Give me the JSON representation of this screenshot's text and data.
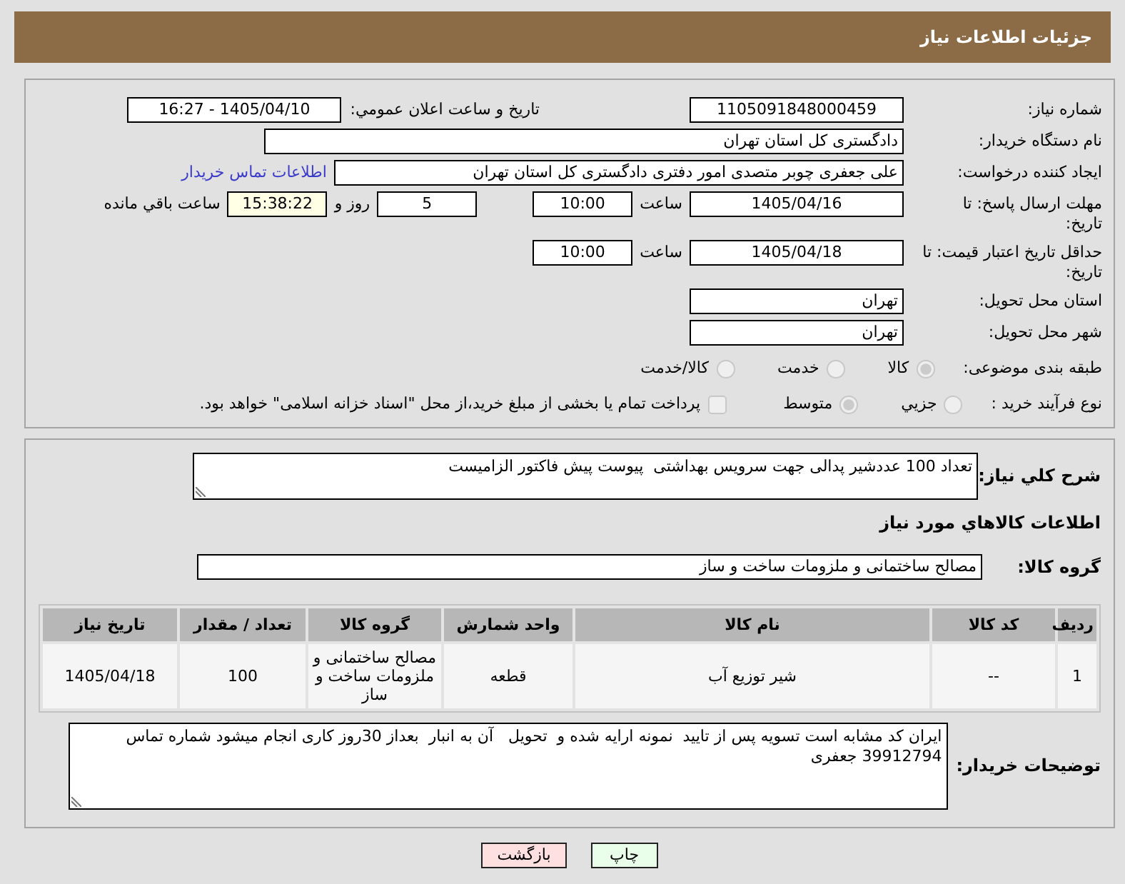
{
  "header": {
    "title": "جزئیات اطلاعات نیاز"
  },
  "need_details": {
    "need_number": {
      "label": "شماره نیاز:",
      "value": "1105091848000459"
    },
    "announcement": {
      "label": "تاریخ و ساعت اعلان عمومي:",
      "value": "1405/04/10 - 16:27"
    },
    "buyer_organization": {
      "label": "نام دستگاه خریدار:",
      "value": "دادگستری کل استان تهران"
    },
    "requester": {
      "label": "ایجاد کننده درخواست:",
      "value": "علی جعفری چوبر متصدی امور دفتری دادگستری کل استان تهران",
      "contact_link": "اطلاعات تماس خریدار"
    },
    "response_deadline": {
      "label": "مهلت ارسال پاسخ: تا تاریخ:",
      "date": "1405/04/16",
      "time_label": "ساعت",
      "time": "10:00",
      "days": "5",
      "days_label": "روز و",
      "remaining_time": "15:38:22",
      "remaining_label": "ساعت باقي مانده"
    },
    "price_validity": {
      "label": "حداقل تاریخ اعتبار قیمت: تا تاریخ:",
      "date": "1405/04/18",
      "time_label": "ساعت",
      "time": "10:00"
    },
    "delivery_province": {
      "label": "استان محل تحویل:",
      "value": "تهران"
    },
    "delivery_city": {
      "label": "شهر محل تحویل:",
      "value": "تهران"
    },
    "subject_category": {
      "label": "طبقه بندی موضوعی:",
      "options": [
        {
          "label": "کالا",
          "selected": true,
          "disabled": true
        },
        {
          "label": "خدمت",
          "selected": false,
          "disabled": true
        },
        {
          "label": "کالا/خدمت",
          "selected": false,
          "disabled": true
        }
      ]
    },
    "purchase_process": {
      "label": "نوع فرآیند خرید :",
      "options": [
        {
          "label": "جزيي",
          "selected": false,
          "disabled": true
        },
        {
          "label": "متوسط",
          "selected": true,
          "disabled": true
        }
      ],
      "treasury_payment": {
        "label": "پرداخت تمام یا بخشی از مبلغ خرید،از محل \"اسناد خزانه اسلامی\" خواهد بود.",
        "checked": false,
        "disabled": true
      }
    }
  },
  "need_items": {
    "description": {
      "label": "شرح کلي نیاز:",
      "value": "تعداد 100 عددشیر پدالی جهت سرویس بهداشتی  پیوست پیش فاکتور الزامیست"
    },
    "items_heading": "اطلاعات کالاهاي مورد نیاز",
    "goods_group": {
      "label": "گروه کالا:",
      "value": "مصالح ساختمانی و ملزومات ساخت و ساز"
    },
    "table": {
      "columns": [
        "ردیف",
        "کد کالا",
        "نام کالا",
        "واحد شمارش",
        "گروه کالا",
        "تعداد / مقدار",
        "تاریخ نیاز"
      ],
      "rows": [
        [
          "1",
          "--",
          "شیر توزیع آب",
          "قطعه",
          "مصالح ساختمانی و ملزومات ساخت و ساز",
          "100",
          "1405/04/18"
        ]
      ]
    },
    "buyer_notes": {
      "label": "توضیحات خریدار:",
      "value": "ایران کد مشابه است تسویه پس از تایید  نمونه ارایه شده و  تحویل   آن به انبار  بعداز 30روز کاری انجام میشود شماره تماس 39912794 جعفری"
    }
  },
  "buttons": [
    {
      "kind": "print",
      "label": "چاپ"
    },
    {
      "kind": "back",
      "label": "بازگشت"
    }
  ]
}
